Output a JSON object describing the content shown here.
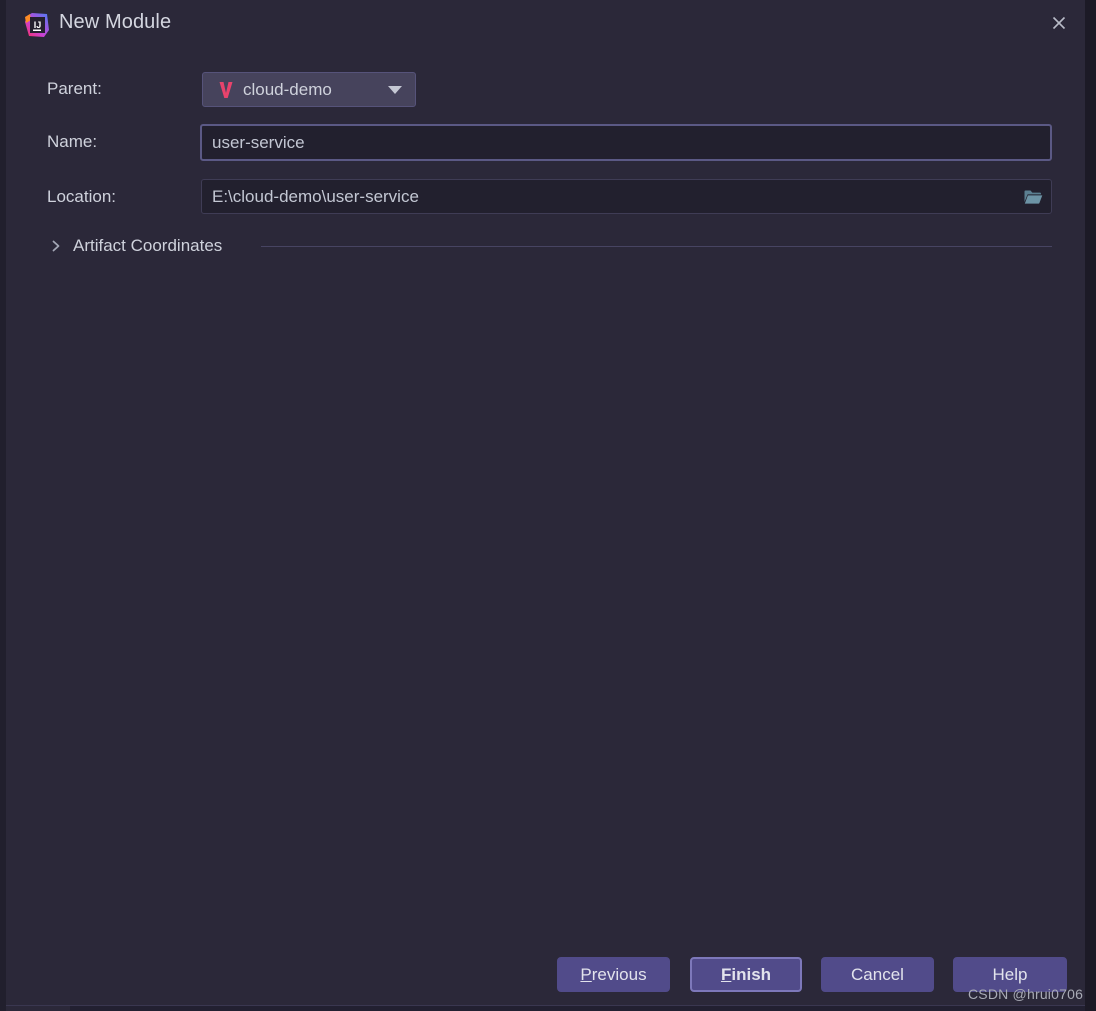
{
  "window": {
    "title": "New Module",
    "app_icon": "intellij-idea-logo",
    "close_icon": "close-icon"
  },
  "colors": {
    "dialog_bg": "#2b2839",
    "field_bg": "#22202e",
    "combo_bg": "#46435c",
    "focus_border": "#5b5985",
    "button_bg": "#514b8a",
    "default_button_border": "#7d78ba",
    "text": "#cfd2dc",
    "maven_icon": "#e8436c",
    "folder_icon": "#5b7f91",
    "separator": "#474462"
  },
  "form": {
    "parent": {
      "label": "Parent:",
      "value": "cloud-demo",
      "icon": "maven-module-icon",
      "arrow_icon": "chevron-down-icon"
    },
    "name": {
      "label": "Name:",
      "value": "user-service",
      "focused": true
    },
    "location": {
      "label": "Location:",
      "value": "E:\\cloud-demo\\user-service",
      "browse_icon": "folder-open-icon"
    }
  },
  "sections": [
    {
      "title": "Artifact Coordinates",
      "expanded": false,
      "expander_icon": "chevron-right-icon"
    }
  ],
  "buttons": {
    "previous": {
      "label": "Previous",
      "mnemonic": "P",
      "rest": "revious"
    },
    "finish": {
      "label": "Finish",
      "mnemonic": "F",
      "rest": "inish",
      "is_default": true
    },
    "cancel": {
      "label": "Cancel"
    },
    "help": {
      "label": "Help"
    }
  },
  "watermark": "CSDN @hrui0706"
}
